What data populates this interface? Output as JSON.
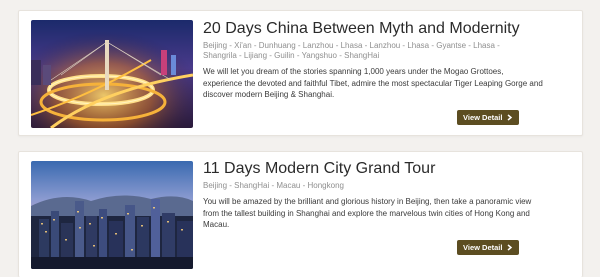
{
  "tours": [
    {
      "title": "20 Days China Between Myth and Modernity",
      "route": "Beijing - Xi'an - Dunhuang - Lanzhou - Lhasa - Lanzhou - Lhasa - Gyantse - Lhasa - Shangrila - Lijiang - Guilin - Yangshuo - ShangHai",
      "description": "We will let you dream of the stories spanning 1,000 years under the Mogao Grottoes, experience the devoted and faithful Tibet, admire the most spectacular Tiger Leaping Gorge and discover modern Beijing & Shanghai.",
      "button_label": "View Detail",
      "image": "shanghai-nanpu-bridge-night-photo"
    },
    {
      "title": "11 Days Modern City Grand Tour",
      "route": "Beijing - ShangHai - Macau - Hongkong",
      "description": "You will be amazed by the brilliant and glorious history in Beijing, then take a panoramic view from the tallest building in Shanghai and explore the marvelous twin cities of Hong Kong and Macau.",
      "button_label": "View Detail",
      "image": "hong-kong-skyline-dusk-photo"
    }
  ],
  "colors": {
    "button_bg": "#5c4d21",
    "title": "#2b2b2b",
    "route": "#8f8f8f"
  },
  "icons": {
    "button_arrow": "chevron-right-icon"
  }
}
